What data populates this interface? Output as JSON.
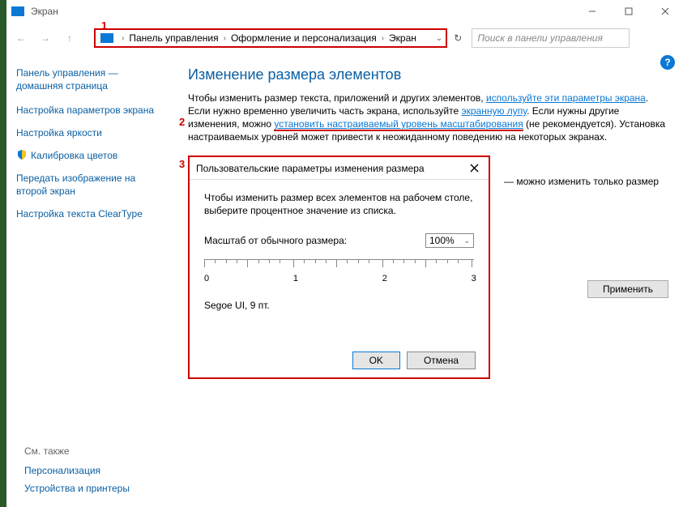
{
  "window": {
    "title": "Экран",
    "minimize": "—",
    "maximize": "□",
    "close": "×"
  },
  "breadcrumb": {
    "items": [
      "Панель управления",
      "Оформление и персонализация",
      "Экран"
    ]
  },
  "search": {
    "placeholder": "Поиск в панели управления"
  },
  "annotations": {
    "a1": "1",
    "a2": "2",
    "a3": "3"
  },
  "sidebar": {
    "header": "Панель управления — домашняя страница",
    "links": [
      {
        "label": "Настройка параметров экрана",
        "shield": false
      },
      {
        "label": "Настройка яркости",
        "shield": false
      },
      {
        "label": "Калибровка цветов",
        "shield": true
      },
      {
        "label": "Передать изображение на второй экран",
        "shield": false
      },
      {
        "label": "Настройка текста ClearType",
        "shield": false
      }
    ]
  },
  "bottom": {
    "header": "См. также",
    "links": [
      "Персонализация",
      "Устройства и принтеры"
    ]
  },
  "main": {
    "heading": "Изменение размера элементов",
    "p_pre1": "Чтобы изменить размер текста, приложений и других элементов, ",
    "p_link1": "используйте эти параметры экрана",
    "p_post1": ".",
    "p_pre2": "Если нужно временно увеличить часть экрана, используйте ",
    "p_link2": "экранную лупу",
    "p_post2": ". Если нужны другие изменения, можно ",
    "p_link3": "установить настраиваемый уровень масштабирования",
    "p_post3": " (не рекомендуется). Установка настраиваемых уровней может привести к неожиданному поведению на некоторых экранах.",
    "bullet": "—  можно изменить только размер",
    "apply": "Применить"
  },
  "dialog": {
    "title": "Пользовательские параметры изменения размера",
    "text": "Чтобы изменить размер всех элементов на рабочем столе, выберите процентное значение из списка.",
    "scale_label": "Масштаб от обычного размера:",
    "scale_value": "100%",
    "ruler_labels": [
      "0",
      "1",
      "2",
      "3"
    ],
    "font_sample": "Segoe UI, 9 пт.",
    "ok": "OK",
    "cancel": "Отмена"
  }
}
